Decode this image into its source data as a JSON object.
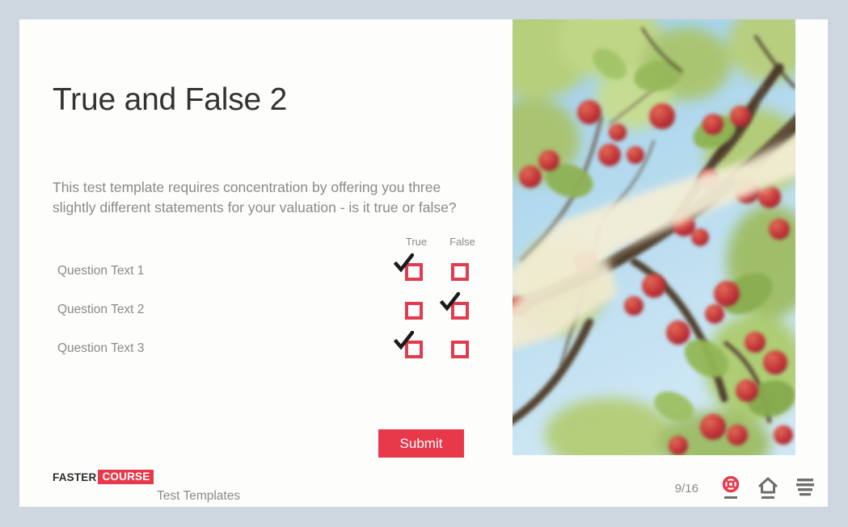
{
  "theme": {
    "page_background": "#ced6e0",
    "card_background": "#fdfdfc",
    "accent_red": "#e8394b",
    "checkbox_red": "#e13b4d",
    "muted_text": "#8a8a8a",
    "title_text": "#333333"
  },
  "slide": {
    "title": "True and False 2",
    "intro": "This test template requires concentration by offering you three slightly different statements for your valuation - is it true or false?"
  },
  "quiz": {
    "columns": [
      "True",
      "False"
    ],
    "rows": [
      {
        "label": "Question Text 1",
        "true_checked": true,
        "false_checked": false
      },
      {
        "label": "Question Text 2",
        "true_checked": false,
        "false_checked": true
      },
      {
        "label": "Question Text 3",
        "true_checked": true,
        "false_checked": false
      }
    ]
  },
  "actions": {
    "submit_label": "Submit"
  },
  "footer": {
    "brand_part1": "FASTER",
    "brand_part2": "COURSE",
    "subtitle": "Test Templates",
    "page_counter": "9/16",
    "icons": [
      {
        "name": "help-lifebuoy-icon",
        "color": "#e8394b"
      },
      {
        "name": "home-icon",
        "color": "#6e6e6e"
      },
      {
        "name": "menu-icon",
        "color": "#6e6e6e"
      }
    ]
  },
  "hero_image": {
    "alt": "apple-tree-with-red-apples-against-blue-sky",
    "sky_color": "#a9d3ea",
    "foliage_color": "#a8c36a",
    "apple_color": "#c9363a",
    "branch_color": "#4a3a2c",
    "band_color": "#f2ecd2"
  }
}
